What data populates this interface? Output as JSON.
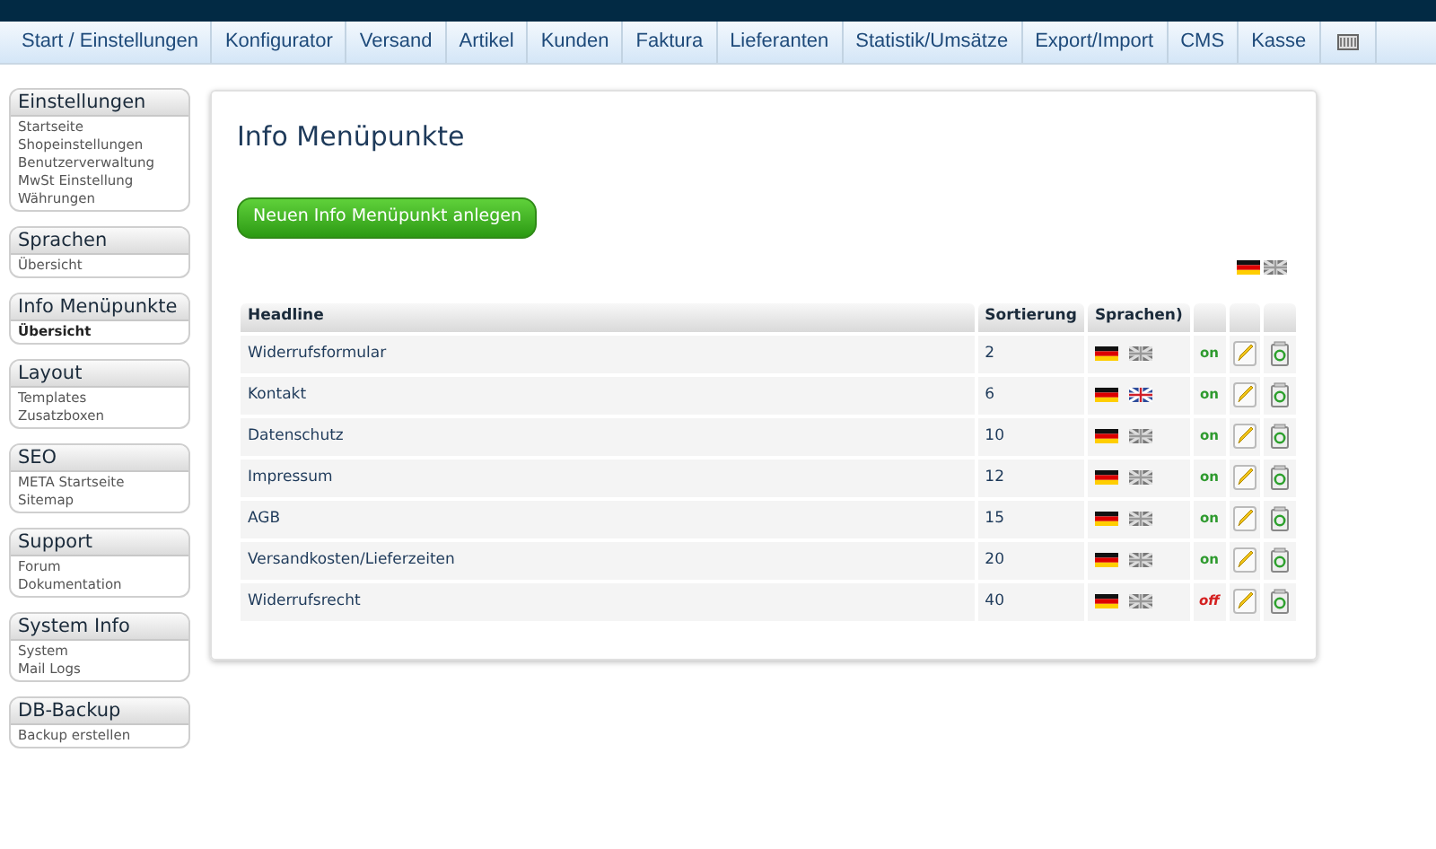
{
  "tabs": [
    {
      "label": "Start / Einstellungen",
      "selected": false
    },
    {
      "label": "Konfigurator",
      "selected": false
    },
    {
      "label": "Versand",
      "selected": false
    },
    {
      "label": "Artikel",
      "selected": false
    },
    {
      "label": "Kunden",
      "selected": false
    },
    {
      "label": "Faktura",
      "selected": false
    },
    {
      "label": "Lieferanten",
      "selected": false
    },
    {
      "label": "Statistik/Umsätze",
      "selected": false
    },
    {
      "label": "Export/Import",
      "selected": false
    },
    {
      "label": "CMS",
      "selected": false
    },
    {
      "label": "Kasse",
      "selected": false
    }
  ],
  "sidebar": [
    {
      "title": "Einstellungen",
      "items": [
        {
          "label": "Startseite",
          "selected": false
        },
        {
          "label": "Shopeinstellungen",
          "selected": false
        },
        {
          "label": "Benutzerverwaltung",
          "selected": false
        },
        {
          "label": "MwSt Einstellung",
          "selected": false
        },
        {
          "label": "Währungen",
          "selected": false
        }
      ]
    },
    {
      "title": "Sprachen",
      "items": [
        {
          "label": "Übersicht",
          "selected": false
        }
      ]
    },
    {
      "title": "Info Menüpunkte",
      "items": [
        {
          "label": "Übersicht",
          "selected": true
        }
      ]
    },
    {
      "title": "Layout",
      "items": [
        {
          "label": "Templates",
          "selected": false
        },
        {
          "label": "Zusatzboxen",
          "selected": false
        }
      ]
    },
    {
      "title": "SEO",
      "items": [
        {
          "label": "META Startseite",
          "selected": false
        },
        {
          "label": "Sitemap",
          "selected": false
        }
      ]
    },
    {
      "title": "Support",
      "items": [
        {
          "label": "Forum",
          "selected": false
        },
        {
          "label": "Dokumentation",
          "selected": false
        }
      ]
    },
    {
      "title": "System Info",
      "items": [
        {
          "label": "System",
          "selected": false
        },
        {
          "label": "Mail Logs",
          "selected": false
        }
      ]
    },
    {
      "title": "DB-Backup",
      "items": [
        {
          "label": "Backup erstellen",
          "selected": false
        }
      ]
    }
  ],
  "page_title": "Info Menüpunkte",
  "new_button": "Neuen Info Menüpunkt anlegen",
  "language_filter": {
    "de_active": true,
    "en_active": false
  },
  "table": {
    "columns": [
      "Headline",
      "Sortierung",
      "Sprachen)"
    ],
    "rows": [
      {
        "headline": "Widerrufsformular",
        "sort": "2",
        "de_active": true,
        "en_active": false,
        "status": "on",
        "active": true
      },
      {
        "headline": "Kontakt",
        "sort": "6",
        "de_active": true,
        "en_active": true,
        "status": "on",
        "active": true
      },
      {
        "headline": "Datenschutz",
        "sort": "10",
        "de_active": true,
        "en_active": false,
        "status": "on",
        "active": true
      },
      {
        "headline": "Impressum",
        "sort": "12",
        "de_active": true,
        "en_active": false,
        "status": "on",
        "active": true
      },
      {
        "headline": "AGB",
        "sort": "15",
        "de_active": true,
        "en_active": false,
        "status": "on",
        "active": true
      },
      {
        "headline": "Versandkosten/Lieferzeiten",
        "sort": "20",
        "de_active": true,
        "en_active": false,
        "status": "on",
        "active": true
      },
      {
        "headline": "Widerrufsrecht",
        "sort": "40",
        "de_active": true,
        "en_active": false,
        "status": "off",
        "active": false
      }
    ]
  }
}
